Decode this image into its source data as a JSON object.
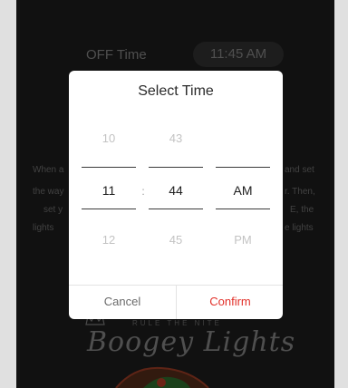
{
  "background": {
    "off_time_label": "OFF Time",
    "off_time_value": "11:45 AM",
    "left_fragments": [
      "When a",
      "the way",
      "set y",
      "lights"
    ],
    "right_fragments": [
      "and set",
      "r. Then,",
      "E, the",
      "e lights"
    ],
    "logo_tagline": "RULE THE NITE",
    "logo_text": "Boogey Lights"
  },
  "dialog": {
    "title": "Select Time",
    "hour": {
      "above": "10",
      "selected": "11",
      "below": "12"
    },
    "separator": ":",
    "minute": {
      "above": "43",
      "selected": "44",
      "below": "45"
    },
    "period": {
      "selected": "AM",
      "below": "PM"
    },
    "cancel_label": "Cancel",
    "confirm_label": "Confirm",
    "accent_color": "#e2312a"
  }
}
